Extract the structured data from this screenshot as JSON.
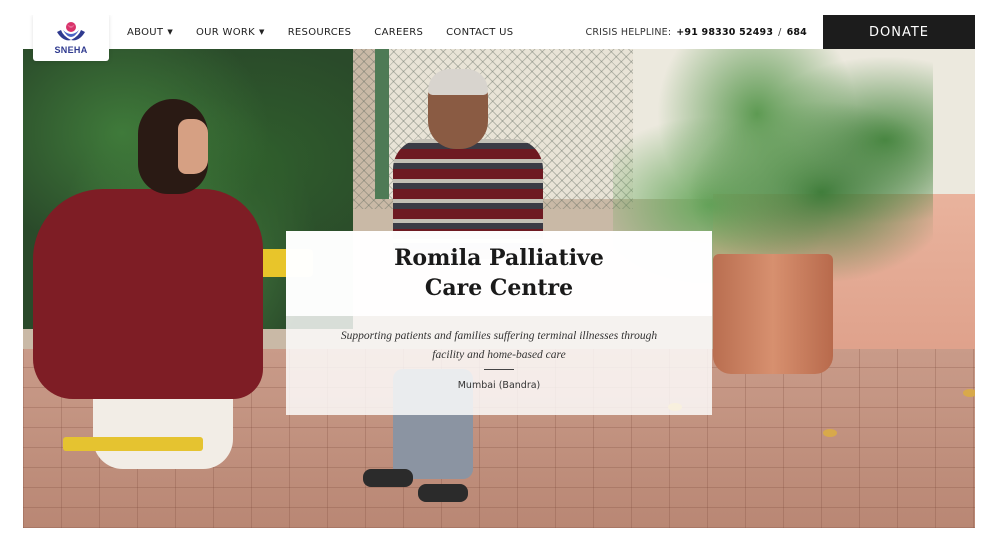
{
  "brand": {
    "logo_text": "SNEHA"
  },
  "nav": {
    "items": [
      {
        "label": "ABOUT",
        "dropdown": true
      },
      {
        "label": "OUR WORK",
        "dropdown": true
      },
      {
        "label": "RESOURCES",
        "dropdown": false
      },
      {
        "label": "CAREERS",
        "dropdown": false
      },
      {
        "label": "CONTACT US",
        "dropdown": false
      }
    ]
  },
  "helpline": {
    "label": "CRISIS HELPLINE:",
    "number": "+91 98330 52493",
    "separator": "/",
    "extension": "684"
  },
  "donate": {
    "label": "DONATE"
  },
  "hero": {
    "title": "Romila Palliative Care Centre",
    "subtitle": "Supporting patients and families suffering terminal illnesses through facility and home-based care",
    "location": "Mumbai (Bandra)"
  },
  "colors": {
    "donate_bg": "#1c1c1c",
    "logo_blue": "#2f3a8f",
    "logo_pink": "#d9336b",
    "card_bg": "#ffffff"
  },
  "icons": {
    "dropdown": "caret-down-icon",
    "logo": "sneha-logo-icon"
  }
}
